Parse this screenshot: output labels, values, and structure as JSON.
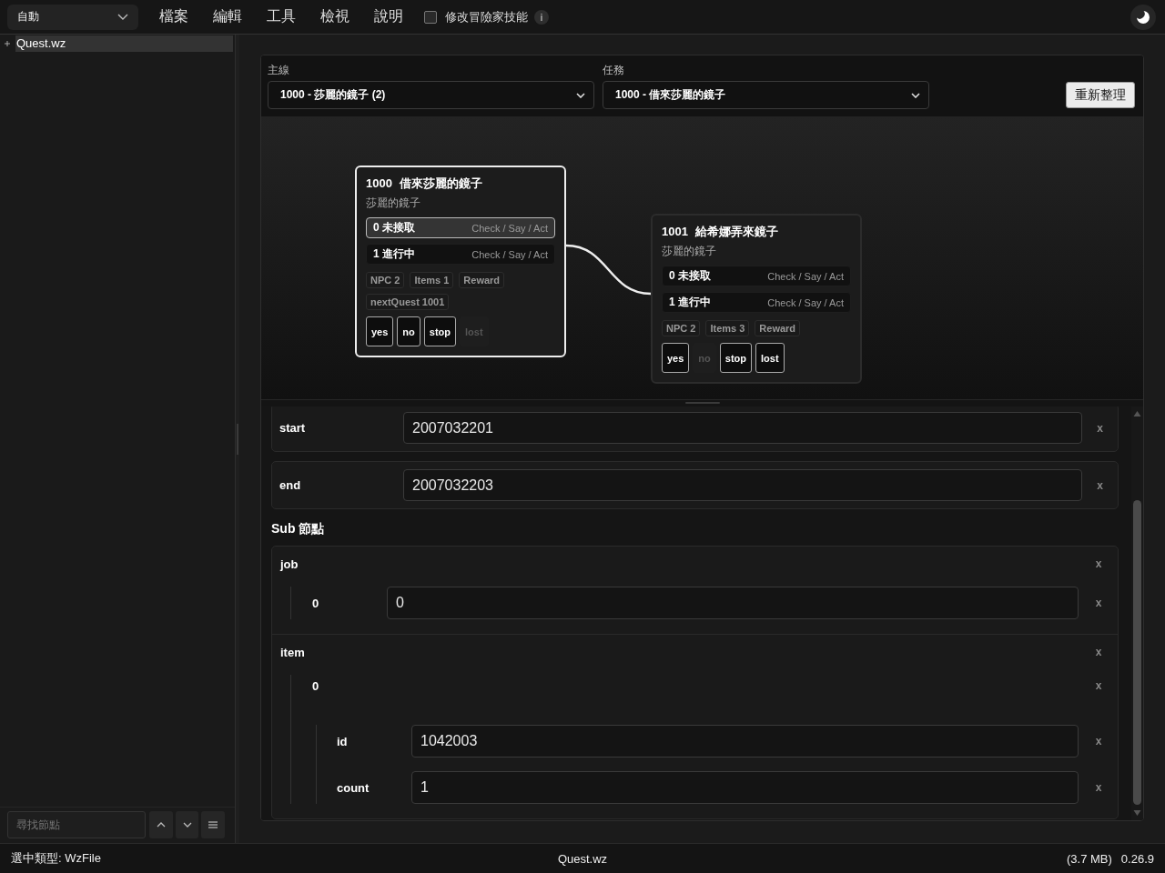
{
  "toolbar": {
    "mode_select": {
      "value": "自動"
    },
    "menu": [
      {
        "label": "檔案"
      },
      {
        "label": "編輯"
      },
      {
        "label": "工具"
      },
      {
        "label": "檢視"
      },
      {
        "label": "說明"
      }
    ],
    "skill_toggle": {
      "label": "修改冒險家技能",
      "checked": false
    },
    "info_button": "i"
  },
  "sidebar": {
    "tree": [
      {
        "label": "Quest.wz",
        "expanded": false,
        "selected": true
      }
    ],
    "search": {
      "placeholder": "尋找節點"
    }
  },
  "quest_panel": {
    "filters": [
      {
        "label": "主線",
        "value": "1000 - 莎麗的鏡子 (2)"
      },
      {
        "label": "任務",
        "value": "1000 - 借來莎麗的鏡子"
      }
    ],
    "refresh_button": "重新整理",
    "graph": {
      "nodes": [
        {
          "number": "1000",
          "title": "借來莎麗的鏡子",
          "subtitle": "莎麗的鏡子",
          "selected": true,
          "states": [
            {
              "label": "0 未接取",
              "detail": "Check / Say / Act",
              "selected": true
            },
            {
              "label": "1 進行中",
              "detail": "Check / Say / Act",
              "selected": false
            }
          ],
          "tags": [
            "NPC 2",
            "Items 1",
            "Reward",
            "nextQuest 1001"
          ],
          "answers": [
            {
              "label": "yes",
              "disabled": false
            },
            {
              "label": "no",
              "disabled": false
            },
            {
              "label": "stop",
              "disabled": false
            },
            {
              "label": "lost",
              "disabled": true
            }
          ]
        },
        {
          "number": "1001",
          "title": "給希娜弄來鏡子",
          "subtitle": "莎麗的鏡子",
          "selected": false,
          "states": [
            {
              "label": "0 未接取",
              "detail": "Check / Say / Act",
              "selected": false
            },
            {
              "label": "1 進行中",
              "detail": "Check / Say / Act",
              "selected": false
            }
          ],
          "tags": [
            "NPC 2",
            "Items 3",
            "Reward"
          ],
          "answers": [
            {
              "label": "yes",
              "disabled": false
            },
            {
              "label": "no",
              "disabled": true
            },
            {
              "label": "stop",
              "disabled": false
            },
            {
              "label": "lost",
              "disabled": false
            }
          ]
        }
      ]
    },
    "fields": [
      {
        "key": "start",
        "value": "2007032201",
        "remove": "x"
      },
      {
        "key": "end",
        "value": "2007032203",
        "remove": "x"
      }
    ],
    "sub_heading": "Sub 節點",
    "sub_nodes": [
      {
        "key": "job",
        "remove": "x",
        "children": [
          {
            "key": "0",
            "value": "0",
            "remove": "x"
          }
        ]
      },
      {
        "key": "item",
        "remove": "x",
        "children": [
          {
            "key": "0",
            "remove": "x",
            "children": [
              {
                "key": "id",
                "value": "1042003",
                "remove": "x"
              },
              {
                "key": "count",
                "value": "1",
                "remove": "x"
              }
            ]
          }
        ]
      }
    ]
  },
  "status_bar": {
    "selection": "選中類型: WzFile",
    "file": "Quest.wz",
    "size": "(3.7 MB)",
    "version": "0.26.9"
  }
}
